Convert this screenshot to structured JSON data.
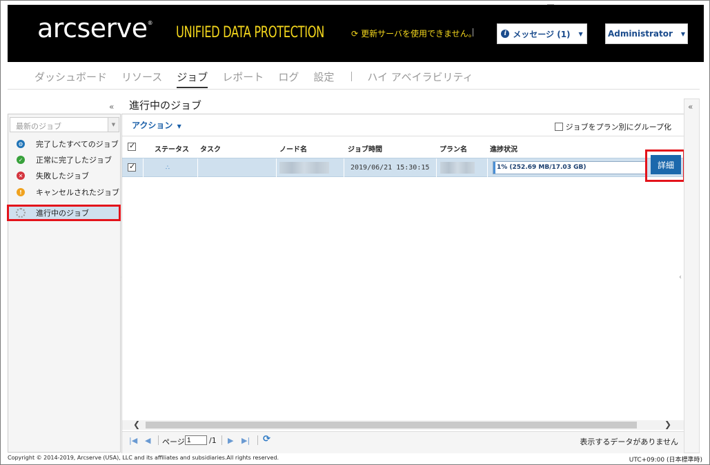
{
  "header": {
    "logo": "arcserve",
    "logo_mark": "®",
    "product": "UNIFIED DATA PROTECTION",
    "update_notice": "更新サーバを使用できません。",
    "messages_label": "メッセージ (1)",
    "user_label": "Administrator",
    "accent_color": "#f3d61c"
  },
  "nav": {
    "items": [
      "ダッシュボード",
      "リソース",
      "ジョブ",
      "レポート",
      "ログ",
      "設定"
    ],
    "extra": "ハイ アベイラビリティ",
    "active": "ジョブ"
  },
  "sidebar": {
    "filter_placeholder": "最新のジョブ",
    "items": [
      {
        "label": "完了したすべてのジョブ",
        "icon": "gear-status-icon"
      },
      {
        "label": "正常に完了したジョブ",
        "icon": "check-circle-icon"
      },
      {
        "label": "失敗したジョブ",
        "icon": "error-circle-icon"
      },
      {
        "label": "キャンセルされたジョブ",
        "icon": "warning-circle-icon"
      }
    ],
    "active_item": "進行中のジョブ"
  },
  "main": {
    "title": "進行中のジョブ",
    "action_label": "アクション",
    "group_by_plan": "ジョブをプラン別にグループ化",
    "columns": [
      "ステータス",
      "タスク",
      "ノード名",
      "ジョブ時間",
      "プラン名",
      "進捗状況"
    ],
    "row": {
      "job_time": "2019/06/21 15:30:15",
      "progress_text": "1% (252.69 MB/17.03 GB)",
      "progress_fraction": 0.015,
      "details_label": "詳細"
    },
    "pager": {
      "page_label": "ページ",
      "page_value": "1",
      "page_total": "/1",
      "no_data": "表示するデータがありません"
    }
  },
  "footer": {
    "copyright": "Copyright © 2014-2019, Arcserve (USA), LLC and its affiliates and subsidiaries.All rights reserved.",
    "timezone": "UTC+09:00 (日本標準時)"
  }
}
